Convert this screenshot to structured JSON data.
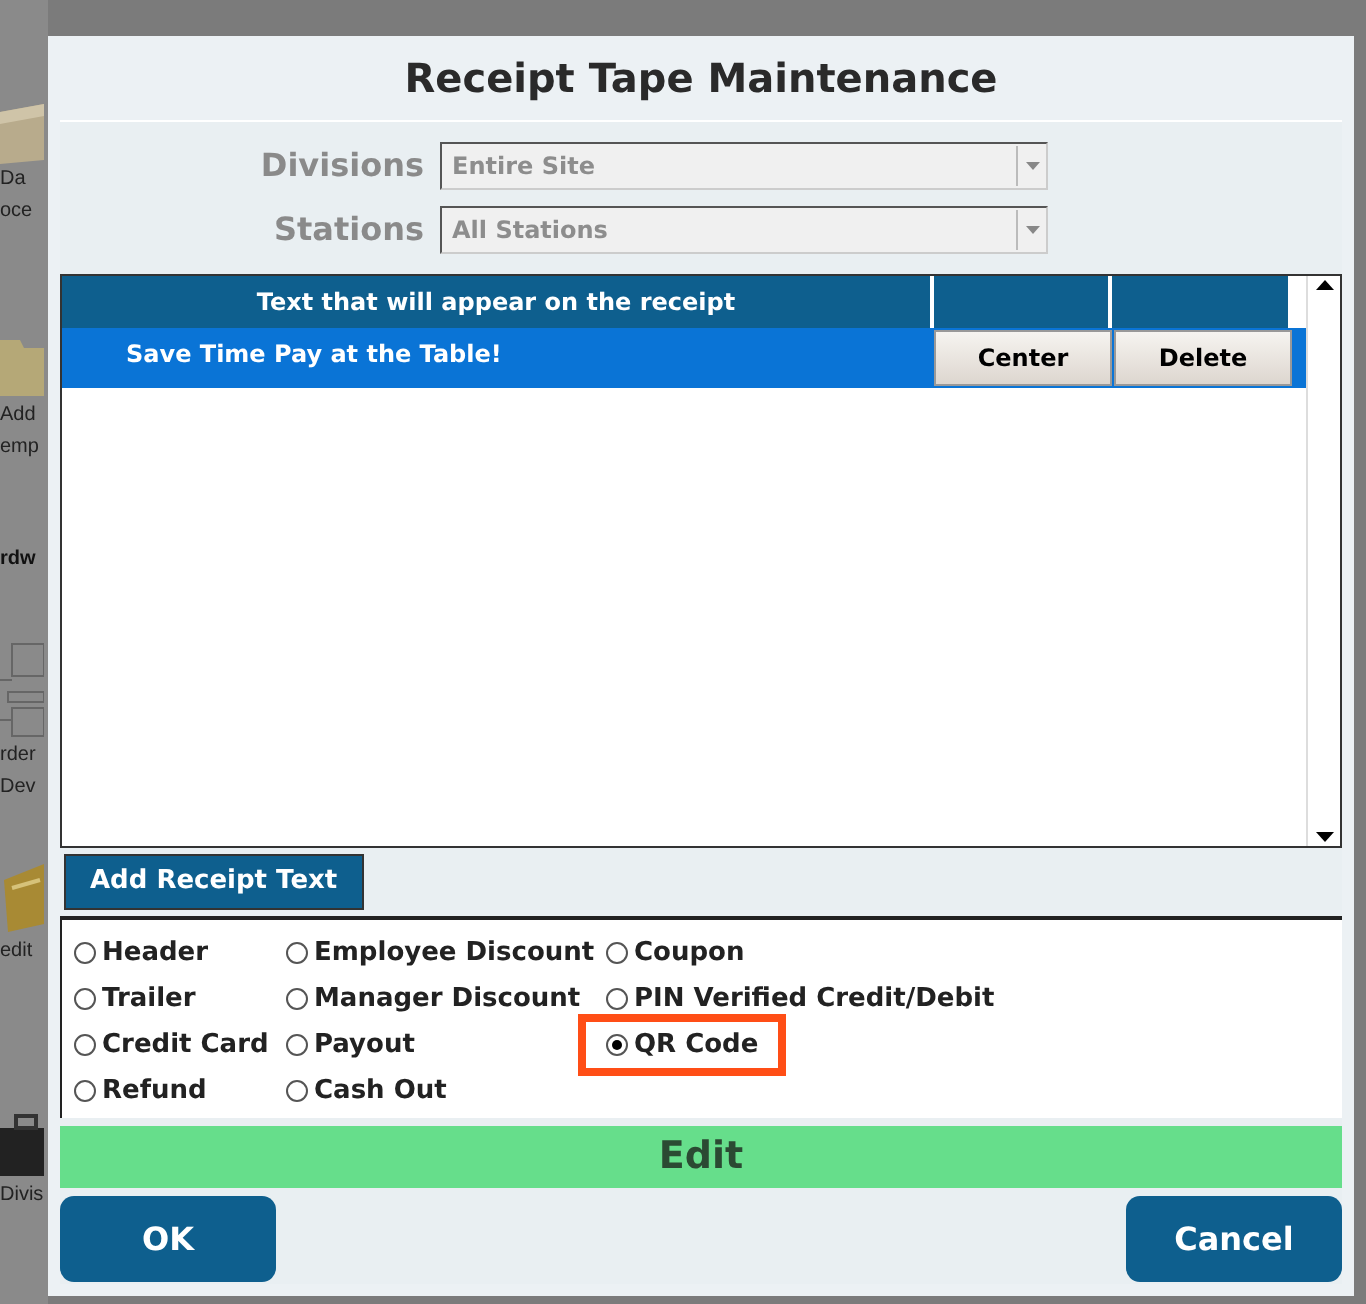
{
  "background": [
    {
      "kind": "box",
      "lines": [
        "Da",
        "oce"
      ]
    },
    {
      "kind": "folder",
      "lines": [
        "Add",
        "emp"
      ]
    },
    {
      "kind": "heading",
      "lines": [
        "rdw"
      ]
    },
    {
      "kind": "diagram",
      "lines": [
        "rder",
        "Dev"
      ]
    },
    {
      "kind": "card",
      "lines": [
        "edit"
      ]
    },
    {
      "kind": "case",
      "lines": [
        "Divis"
      ]
    }
  ],
  "dialog": {
    "title": "Receipt Tape Maintenance",
    "filters": [
      {
        "label": "Divisions",
        "value": "Entire Site"
      },
      {
        "label": "Stations",
        "value": "All Stations"
      }
    ],
    "table": {
      "columns": [
        "Text that will appear on the receipt"
      ],
      "rows": [
        {
          "text": "Save Time Pay at the Table!",
          "selected": true,
          "actions": [
            "Center",
            "Delete"
          ]
        }
      ]
    },
    "add_button": "Add Receipt Text",
    "radios": [
      [
        {
          "label": "Header",
          "selected": false
        },
        {
          "label": "Trailer",
          "selected": false
        },
        {
          "label": "Credit Card",
          "selected": false
        },
        {
          "label": "Refund",
          "selected": false
        }
      ],
      [
        {
          "label": "Employee Discount",
          "selected": false
        },
        {
          "label": "Manager Discount",
          "selected": false
        },
        {
          "label": "Payout",
          "selected": false
        },
        {
          "label": "Cash Out",
          "selected": false
        }
      ],
      [
        {
          "label": "Coupon",
          "selected": false
        },
        {
          "label": "PIN Verified Credit/Debit",
          "selected": false
        },
        {
          "label": "QR Code",
          "selected": true
        }
      ]
    ],
    "mode": "Edit",
    "buttons": [
      "OK",
      "Cancel"
    ]
  }
}
